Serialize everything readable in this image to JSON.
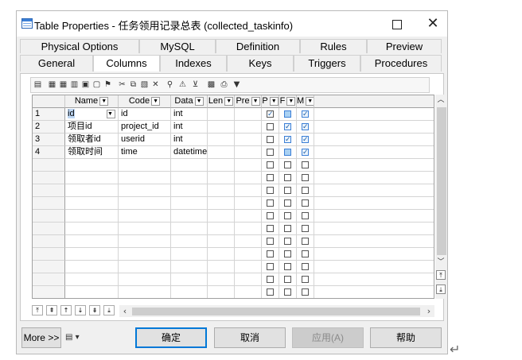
{
  "window": {
    "title": "Table Properties - 任务领用记录总表 (collected_taskinfo)",
    "maximize_icon": "maximize-icon",
    "close_icon": "close-icon",
    "close_glyph": "✕"
  },
  "tabs": {
    "row1": [
      "Physical Options",
      "MySQL",
      "Definition",
      "Rules",
      "Preview"
    ],
    "row2": [
      "General",
      "Columns",
      "Indexes",
      "Keys",
      "Triggers",
      "Procedures"
    ],
    "active": "Columns"
  },
  "grid": {
    "headers": [
      "Name",
      "Code",
      "Data",
      "Len",
      "Pre",
      "P",
      "F",
      "M"
    ],
    "rows": [
      {
        "num": "1",
        "name": "id",
        "code": "id",
        "data": "int",
        "p": true,
        "f": false,
        "m": true
      },
      {
        "num": "2",
        "name": "项目id",
        "code": "project_id",
        "data": "int",
        "p": false,
        "f": true,
        "m": true
      },
      {
        "num": "3",
        "name": "领取者id",
        "code": "userid",
        "data": "int",
        "p": false,
        "f": true,
        "m": true
      },
      {
        "num": "4",
        "name": "领取时间",
        "code": "time",
        "data": "datetime",
        "p": false,
        "f": false,
        "m": true
      }
    ],
    "empty_rows": 12
  },
  "buttons": {
    "more": "More >>",
    "ok": "确定",
    "cancel": "取消",
    "apply": "应用(A)",
    "help": "帮助"
  },
  "colors": {
    "accent": "#0078d7",
    "checkbox_blue": "#3b7fd6"
  }
}
